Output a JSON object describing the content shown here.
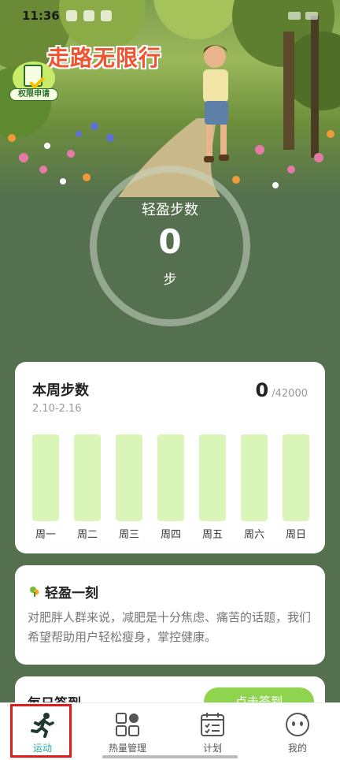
{
  "status_bar": {
    "time": "11:36"
  },
  "header": {
    "app_title": "走路无限行",
    "permission_label": "权限申请"
  },
  "steps_ring": {
    "label": "轻盈步数",
    "value": "0",
    "unit": "步"
  },
  "weekly": {
    "title": "本周步数",
    "date_range": "2.10-2.16",
    "current": "0",
    "goal": "/42000",
    "days": [
      "周一",
      "周二",
      "周三",
      "周四",
      "周五",
      "周六",
      "周日"
    ],
    "values": [
      0,
      0,
      0,
      0,
      0,
      0,
      0
    ]
  },
  "intro": {
    "title": "轻盈一刻",
    "text": "对肥胖人群来说，减肥是十分焦虑、痛苦的话题，我们希望帮助用户轻松瘦身，掌控健康。"
  },
  "checkin": {
    "title": "每日签到",
    "button": "点击签到"
  },
  "nav": {
    "items": [
      {
        "label": "运动",
        "icon": "running-icon"
      },
      {
        "label": "热量管理",
        "icon": "grid-apps-icon"
      },
      {
        "label": "计划",
        "icon": "calendar-checklist-icon"
      },
      {
        "label": "我的",
        "icon": "face-icon"
      }
    ]
  },
  "colors": {
    "background": "#55704f",
    "accent": "#2aa8a0",
    "bar": "#d9f5b8",
    "title": "#f0532f",
    "highlight": "#e01b1b"
  }
}
